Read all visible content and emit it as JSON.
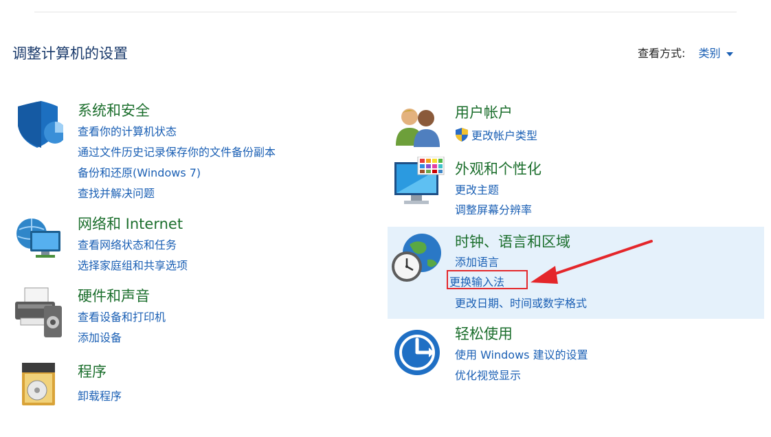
{
  "header": {
    "title": "调整计算机的设置",
    "view_by_label": "查看方式:",
    "view_by_value": "类别"
  },
  "categories": [
    {
      "title": "系统和安全",
      "icon": "shield-icon",
      "links": [
        "查看你的计算机状态",
        "通过文件历史记录保存你的文件备份副本",
        "备份和还原(Windows 7)",
        "查找并解决问题"
      ]
    },
    {
      "title": "网络和 Internet",
      "icon": "network-icon",
      "links": [
        "查看网络状态和任务",
        "选择家庭组和共享选项"
      ]
    },
    {
      "title": "硬件和声音",
      "icon": "printer-icon",
      "links": [
        "查看设备和打印机",
        "添加设备"
      ]
    },
    {
      "title": "程序",
      "icon": "programs-icon",
      "links": [
        "卸载程序"
      ]
    },
    {
      "title": "用户帐户",
      "icon": "users-icon",
      "links": [
        "更改帐户类型"
      ]
    },
    {
      "title": "外观和个性化",
      "icon": "monitor-icon",
      "links": [
        "更改主题",
        "调整屏幕分辨率"
      ]
    },
    {
      "title": "时钟、语言和区域",
      "icon": "globe-clock-icon",
      "links": [
        "添加语言",
        "更换输入法",
        "更改日期、时间或数字格式"
      ]
    },
    {
      "title": "轻松使用",
      "icon": "ease-of-access-icon",
      "links": [
        "使用 Windows 建议的设置",
        "优化视觉显示"
      ]
    }
  ],
  "colors": {
    "category_title": "#1b6e2c",
    "link": "#1a5fb4",
    "highlight_bg": "#e5f1fb",
    "annotation": "#e4262a"
  }
}
